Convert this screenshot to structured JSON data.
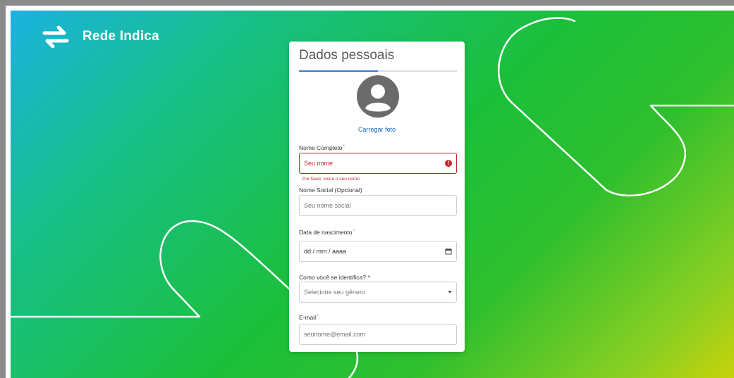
{
  "brand": {
    "name": "Rede Indica",
    "logo_icon": "swap-arrows-icon"
  },
  "card": {
    "title": "Dados pessoais",
    "progress_fraction": 0.5,
    "avatar_icon": "user-avatar-icon",
    "upload_label": "Carregar foto"
  },
  "form": {
    "full_name": {
      "label": "Nome Completo",
      "required_mark": "*",
      "placeholder": "Seu nome",
      "error_icon": "error-icon",
      "error_icon_glyph": "!",
      "error": "Por favor, insira o seu nome"
    },
    "social_name": {
      "label": "Nome Social (Opcional)",
      "placeholder": "Seu nome social"
    },
    "birth_date": {
      "label": "Data de nascimento",
      "required_mark": "*",
      "placeholder": "dd / mm / aaaa",
      "icon": "calendar-icon"
    },
    "gender": {
      "label": "Como você se identifica? *",
      "selected": "Selecione seu gênero",
      "icon": "chevron-down-icon"
    },
    "email": {
      "label": "E-mail",
      "required_mark": "*",
      "placeholder": "seunome@email.com"
    }
  },
  "colors": {
    "gradient_start": "#1ab3e0",
    "gradient_mid": "#1cbf3a",
    "gradient_end": "#c7d20a",
    "accent": "#2f7fd1",
    "error": "#c62828",
    "link": "#1565c0"
  }
}
